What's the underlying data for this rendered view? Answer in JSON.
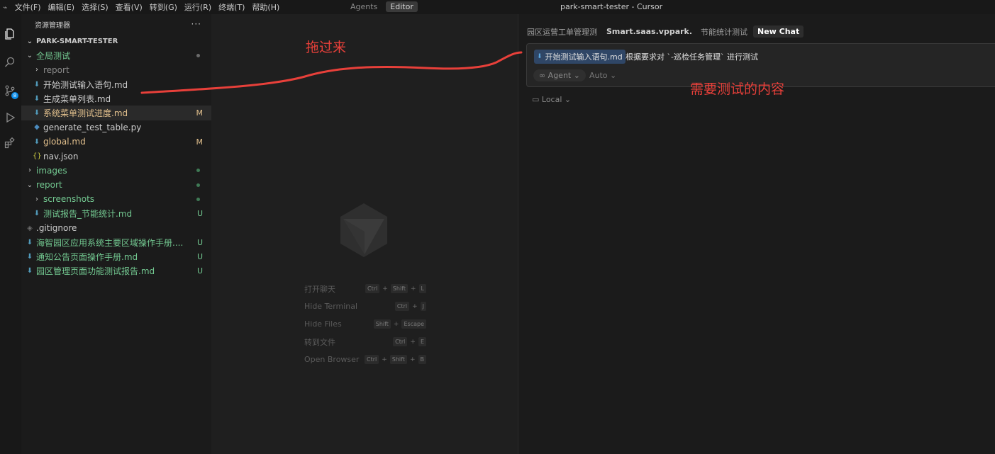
{
  "titlebar": {
    "app_icon": "cursor-logo",
    "menu": [
      "文件(F)",
      "编辑(E)",
      "选择(S)",
      "查看(V)",
      "转到(G)",
      "运行(R)",
      "终端(T)",
      "帮助(H)"
    ],
    "modes": [
      "Agents",
      "Editor"
    ],
    "window_title": "park-smart-tester - Cursor"
  },
  "activitybar": {
    "icons": [
      "files-icon",
      "search-icon",
      "source-control-icon",
      "run-debug-icon",
      "extensions-icon"
    ],
    "scm_badge": "8"
  },
  "sidebar": {
    "title": "资源管理器",
    "more": "···",
    "root": "PARK-SMART-TESTER",
    "items": [
      {
        "label": "全局测试",
        "kind": "folder-open",
        "depth": 1,
        "color": "green",
        "mark": "dot-gray"
      },
      {
        "label": "report",
        "kind": "folder",
        "depth": 2,
        "color": "gray"
      },
      {
        "label": "开始测试输入语句.md",
        "kind": "md",
        "depth": 2,
        "color": "white"
      },
      {
        "label": "生成菜单列表.md",
        "kind": "md",
        "depth": 2,
        "color": "white"
      },
      {
        "label": "系统菜单测试进度.md",
        "kind": "md",
        "depth": 2,
        "color": "yellow",
        "status": "M",
        "selected": true
      },
      {
        "label": "generate_test_table.py",
        "kind": "py",
        "depth": 2,
        "color": "white"
      },
      {
        "label": "global.md",
        "kind": "md",
        "depth": 2,
        "color": "yellow",
        "status": "M"
      },
      {
        "label": "nav.json",
        "kind": "json",
        "depth": 2,
        "color": "white"
      },
      {
        "label": "images",
        "kind": "folder",
        "depth": 1,
        "color": "green",
        "mark": "dot-green"
      },
      {
        "label": "report",
        "kind": "folder-open",
        "depth": 1,
        "color": "green",
        "mark": "dot-green"
      },
      {
        "label": "screenshots",
        "kind": "folder",
        "depth": 2,
        "color": "green",
        "mark": "dot-green"
      },
      {
        "label": "测试报告_节能统计.md",
        "kind": "md",
        "depth": 2,
        "color": "green",
        "status": "U"
      },
      {
        "label": ".gitignore",
        "kind": "git",
        "depth": 1,
        "color": "white"
      },
      {
        "label": "海智园区应用系统主要区域操作手册....",
        "kind": "md",
        "depth": 1,
        "color": "green",
        "status": "U"
      },
      {
        "label": "通知公告页面操作手册.md",
        "kind": "md",
        "depth": 1,
        "color": "green",
        "status": "U"
      },
      {
        "label": "园区管理页面功能测试报告.md",
        "kind": "md",
        "depth": 1,
        "color": "green",
        "status": "U"
      }
    ]
  },
  "editor": {
    "shortcuts": [
      {
        "label": "打开聊天",
        "keys": [
          "Ctrl",
          "Shift",
          "L"
        ]
      },
      {
        "label": "Hide Terminal",
        "keys": [
          "Ctrl",
          "J"
        ]
      },
      {
        "label": "Hide Files",
        "keys": [
          "Shift",
          "Escape"
        ]
      },
      {
        "label": "转到文件",
        "keys": [
          "Ctrl",
          "E"
        ]
      },
      {
        "label": "Open Browser",
        "keys": [
          "Ctrl",
          "Shift",
          "B"
        ]
      }
    ]
  },
  "chat": {
    "tabs": [
      "园区运营工单管理测",
      "Smart.saas.vppark.c",
      "节能统计测试",
      "New Chat"
    ],
    "chip": "开始测试输入语句.md",
    "prompt": "根据要求对 `-巡检任务管理` 进行测试",
    "agent_label": "Agent",
    "auto_label": "Auto",
    "local_label": "Local"
  },
  "annotations": {
    "drag_note": "拖过来",
    "content_note": "需要测试的内容",
    "color": "#e8403a"
  }
}
